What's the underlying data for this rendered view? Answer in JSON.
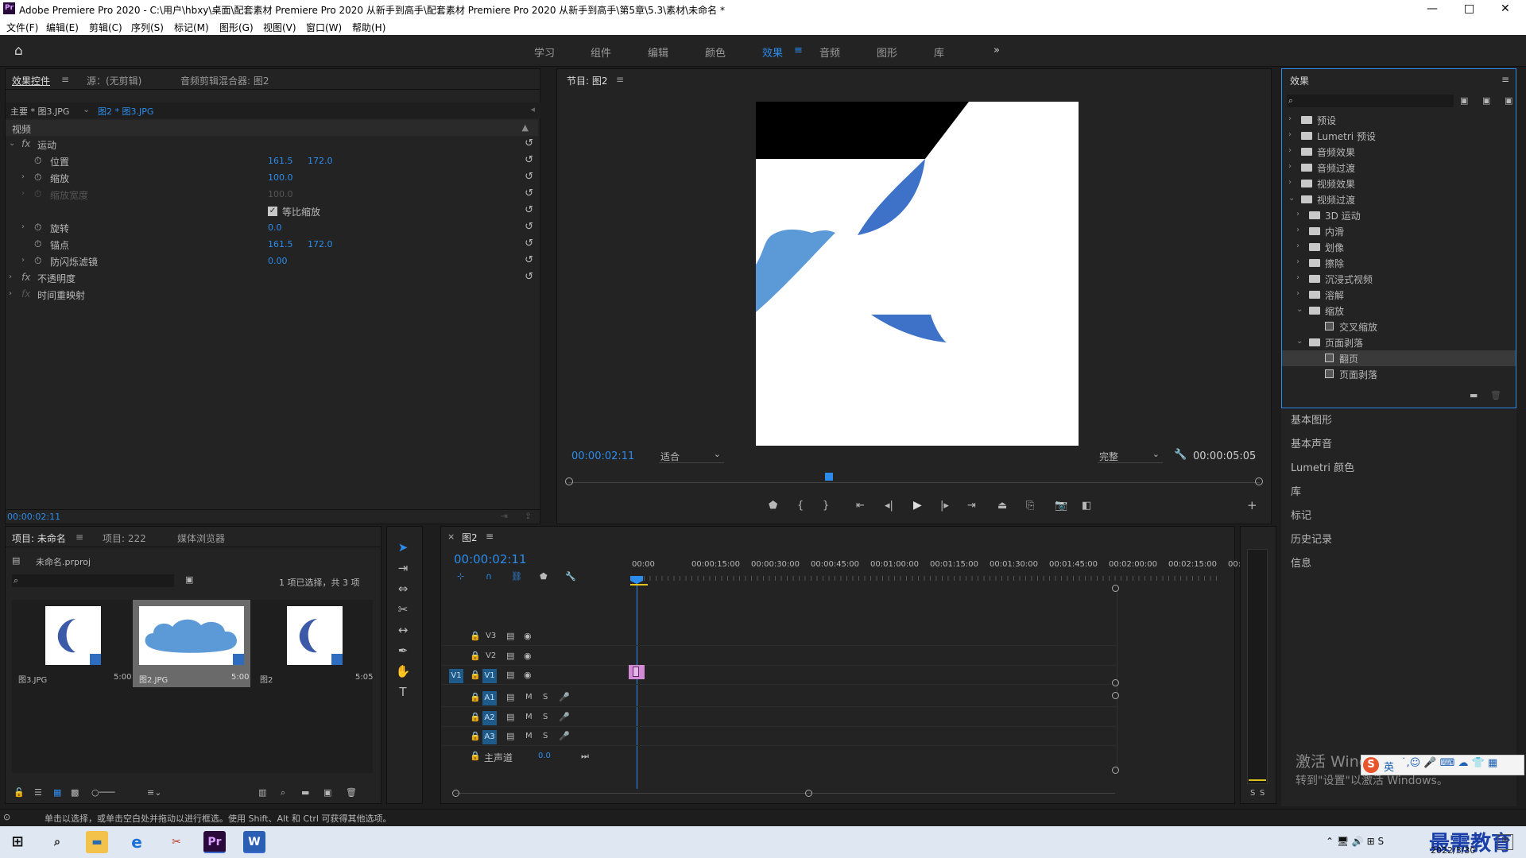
{
  "titlebar": {
    "title": "Adobe Premiere Pro 2020 - C:\\用户\\hbxy\\桌面\\配套素材 Premiere Pro 2020 从新手到高手\\配套素材 Premiere Pro 2020 从新手到高手\\第5章\\5.3\\素材\\未命名 *",
    "min": "—",
    "max": "□",
    "close": "✕"
  },
  "menu": [
    "文件(F)",
    "编辑(E)",
    "剪辑(C)",
    "序列(S)",
    "标记(M)",
    "图形(G)",
    "视图(V)",
    "窗口(W)",
    "帮助(H)"
  ],
  "workspaces": [
    "学习",
    "组件",
    "编辑",
    "颜色",
    "效果",
    "音频",
    "图形",
    "库"
  ],
  "workspace_active": "效果",
  "effect_controls": {
    "tabs": [
      "效果控件",
      "源：(无剪辑)",
      "音频剪辑混合器: 图2"
    ],
    "master": "主要 * 图3.JPG",
    "clip": "图2 * 图3.JPG",
    "section": "视频",
    "motion": "运动",
    "position_label": "位置",
    "position_x": "161.5",
    "position_y": "172.0",
    "scale_label": "缩放",
    "scale_value": "100.0",
    "scale_width_label": "缩放宽度",
    "scale_width_value": "100.0",
    "uniform_label": "等比缩放",
    "rotation_label": "旋转",
    "rotation_value": "0.0",
    "anchor_label": "锚点",
    "anchor_x": "161.5",
    "anchor_y": "172.0",
    "antiflicker_label": "防闪烁滤镜",
    "antiflicker_value": "0.00",
    "opacity": "不透明度",
    "time_remap": "时间重映射",
    "timecode": "00:00:02:11"
  },
  "program": {
    "title": "节目: 图2",
    "timecode": "00:00:02:11",
    "fit": "适合",
    "quality": "完整",
    "duration": "00:00:05:05"
  },
  "effects": {
    "title": "效果",
    "items": [
      {
        "label": "预设",
        "level": 0,
        "type": "folder",
        "open": false
      },
      {
        "label": "Lumetri 预设",
        "level": 0,
        "type": "folder",
        "open": false
      },
      {
        "label": "音频效果",
        "level": 0,
        "type": "folder",
        "open": false
      },
      {
        "label": "音频过渡",
        "level": 0,
        "type": "folder",
        "open": false
      },
      {
        "label": "视频效果",
        "level": 0,
        "type": "folder",
        "open": false
      },
      {
        "label": "视频过渡",
        "level": 0,
        "type": "folder",
        "open": true
      },
      {
        "label": "3D 运动",
        "level": 1,
        "type": "folder",
        "open": false
      },
      {
        "label": "内滑",
        "level": 1,
        "type": "folder",
        "open": false
      },
      {
        "label": "划像",
        "level": 1,
        "type": "folder",
        "open": false
      },
      {
        "label": "擦除",
        "level": 1,
        "type": "folder",
        "open": false
      },
      {
        "label": "沉浸式视频",
        "level": 1,
        "type": "folder",
        "open": false
      },
      {
        "label": "溶解",
        "level": 1,
        "type": "folder",
        "open": false
      },
      {
        "label": "缩放",
        "level": 1,
        "type": "folder",
        "open": true
      },
      {
        "label": "交叉缩放",
        "level": 2,
        "type": "effect",
        "open": false
      },
      {
        "label": "页面剥落",
        "level": 1,
        "type": "folder",
        "open": true
      },
      {
        "label": "翻页",
        "level": 2,
        "type": "effect",
        "open": false,
        "selected": true
      },
      {
        "label": "页面剥落",
        "level": 2,
        "type": "effect",
        "open": false
      }
    ]
  },
  "right_panels": [
    "基本图形",
    "基本声音",
    "Lumetri 颜色",
    "库",
    "标记",
    "历史记录",
    "信息"
  ],
  "project": {
    "tabs": [
      "项目: 未命名",
      "项目: 222",
      "媒体浏览器"
    ],
    "file": "未命名.prproj",
    "selection": "1 项已选择，共 3 项",
    "items": [
      {
        "name": "图3.JPG",
        "duration": "5:00"
      },
      {
        "name": "图2.JPG",
        "duration": "5:00"
      },
      {
        "name": "图2",
        "duration": "5:05"
      }
    ]
  },
  "timeline": {
    "tab": "图2",
    "timecode": "00:00:02:11",
    "ruler": [
      "00:00",
      "00:00:15:00",
      "00:00:30:00",
      "00:00:45:00",
      "00:01:00:00",
      "00:01:15:00",
      "00:01:30:00",
      "00:01:45:00",
      "00:02:00:00",
      "00:02:15:00",
      "00:"
    ],
    "video_tracks": [
      "V3",
      "V2",
      "V1"
    ],
    "audio_tracks": [
      "A1",
      "A2",
      "A3"
    ],
    "source_patch": "V1",
    "master": "主声道",
    "master_value": "0.0",
    "m": "M",
    "s": "S"
  },
  "meter": {
    "left": "S",
    "right": "S"
  },
  "status_bar": "单击以选择，或单击空白处并拖动以进行框选。使用 Shift、Alt 和 Ctrl 可获得其他选项。",
  "watermark": {
    "line1": "激活 Windows",
    "line2": "转到\"设置\"以激活 Windows。"
  },
  "tray": {
    "ime": "英",
    "date": "2022/3/30",
    "brand": "最需教育"
  }
}
